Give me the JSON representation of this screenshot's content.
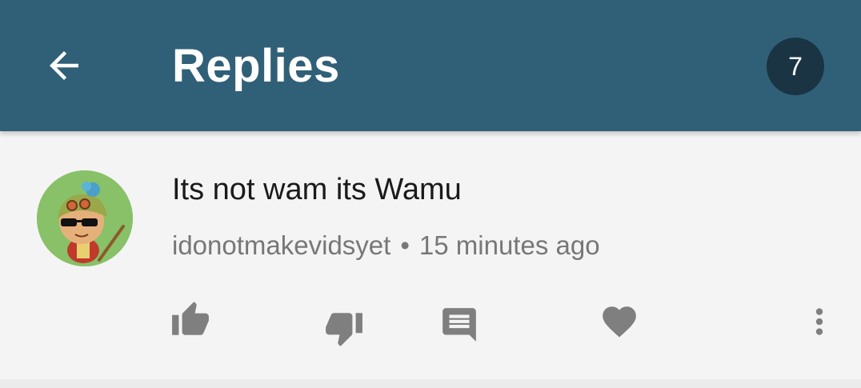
{
  "app_bar": {
    "title": "Replies",
    "reply_count": "7",
    "back_icon": "arrow-left-icon",
    "background": "#306078",
    "badge_color": "#1a3444"
  },
  "comment": {
    "text": "Its not wam its Wamu",
    "author": "idonotmakevidsyet",
    "separator": "•",
    "time": "15 minutes ago",
    "avatar_icon": "avatar-character",
    "actions": [
      {
        "name": "like",
        "icon": "thumb-up-icon"
      },
      {
        "name": "dislike",
        "icon": "thumb-down-icon"
      },
      {
        "name": "reply",
        "icon": "comment-icon"
      },
      {
        "name": "heart",
        "icon": "heart-icon"
      },
      {
        "name": "more",
        "icon": "more-vert-icon"
      }
    ]
  }
}
